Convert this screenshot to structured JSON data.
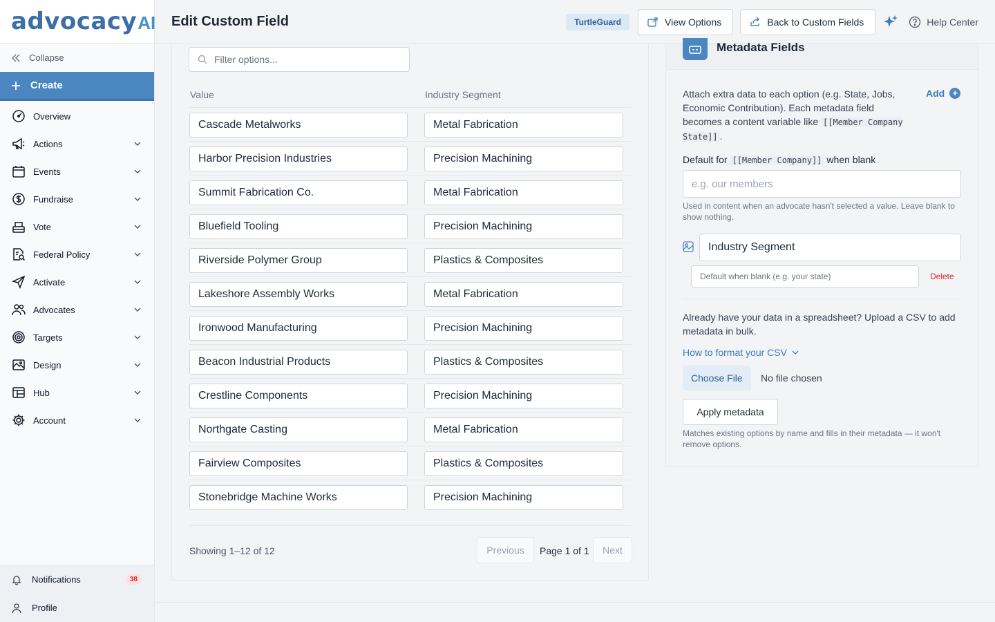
{
  "brand": {
    "logo_main": "advocacy",
    "logo_suffix": "AI"
  },
  "sidebar": {
    "collapse_label": "Collapse",
    "create_label": "Create",
    "items": [
      {
        "label": "Overview",
        "icon": "gauge-icon",
        "chevron": false
      },
      {
        "label": "Actions",
        "icon": "megaphone-icon",
        "chevron": true
      },
      {
        "label": "Events",
        "icon": "calendar-icon",
        "chevron": true
      },
      {
        "label": "Fundraise",
        "icon": "dollar-icon",
        "chevron": true
      },
      {
        "label": "Vote",
        "icon": "ballot-box-icon",
        "chevron": true
      },
      {
        "label": "Federal Policy",
        "icon": "document-search-icon",
        "chevron": true
      },
      {
        "label": "Activate",
        "icon": "paper-plane-icon",
        "chevron": true
      },
      {
        "label": "Advocates",
        "icon": "users-icon",
        "chevron": true
      },
      {
        "label": "Targets",
        "icon": "target-icon",
        "chevron": true
      },
      {
        "label": "Design",
        "icon": "palette-icon",
        "chevron": true
      },
      {
        "label": "Hub",
        "icon": "browser-icon",
        "chevron": true
      },
      {
        "label": "Account",
        "icon": "gear-icon",
        "chevron": true
      }
    ],
    "notifications_label": "Notifications",
    "notifications_count": "38",
    "profile_label": "Profile"
  },
  "header": {
    "title": "Edit Custom Field",
    "org_tag": "TurtleGuard",
    "view_options_label": "View Options",
    "back_label": "Back to Custom Fields",
    "help_label": "Help Center"
  },
  "options": {
    "filter_placeholder": "Filter options...",
    "col_value": "Value",
    "col_segment": "Industry Segment",
    "rows": [
      {
        "value": "Cascade Metalworks",
        "segment": "Metal Fabrication"
      },
      {
        "value": "Harbor Precision Industries",
        "segment": "Precision Machining"
      },
      {
        "value": "Summit Fabrication Co.",
        "segment": "Metal Fabrication"
      },
      {
        "value": "Bluefield Tooling",
        "segment": "Precision Machining"
      },
      {
        "value": "Riverside Polymer Group",
        "segment": "Plastics & Composites"
      },
      {
        "value": "Lakeshore Assembly Works",
        "segment": "Metal Fabrication"
      },
      {
        "value": "Ironwood Manufacturing",
        "segment": "Precision Machining"
      },
      {
        "value": "Beacon Industrial Products",
        "segment": "Plastics & Composites"
      },
      {
        "value": "Crestline Components",
        "segment": "Precision Machining"
      },
      {
        "value": "Northgate Casting",
        "segment": "Metal Fabrication"
      },
      {
        "value": "Fairview Composites",
        "segment": "Plastics & Composites"
      },
      {
        "value": "Stonebridge Machine Works",
        "segment": "Precision Machining"
      }
    ],
    "showing": "Showing 1–12 of 12",
    "prev_label": "Previous",
    "page_info": "Page 1 of 1",
    "next_label": "Next"
  },
  "metadata": {
    "title": "Metadata Fields",
    "desc_before": "Attach extra data to each option (e.g. State, Jobs, Economic Contribution). Each metadata field becomes a content variable like ",
    "desc_code": "[[Member Company State]]",
    "desc_after": ".",
    "add_label": "Add",
    "default_label_before": "Default for ",
    "default_label_code": "[[Member Company]]",
    "default_label_after": " when blank",
    "default_placeholder": "e.g. our members",
    "default_help": "Used in content when an advocate hasn't selected a value. Leave blank to show nothing.",
    "field_name": "Industry Segment",
    "field_blank_placeholder": "Default when blank (e.g. your state)",
    "delete_label": "Delete",
    "csv_text": "Already have your data in a spreadsheet? Upload a CSV to add metadata in bulk.",
    "howto_label": "How to format your CSV",
    "choose_label": "Choose File",
    "no_file_label": "No file chosen",
    "apply_label": "Apply metadata",
    "apply_note": "Matches existing options by name and fills in their metadata — it won't remove options."
  }
}
